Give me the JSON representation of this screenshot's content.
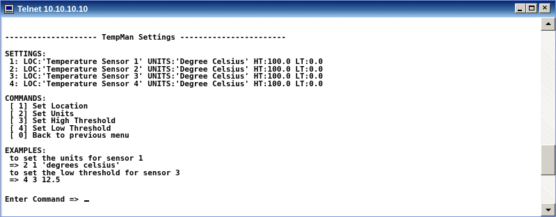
{
  "window": {
    "title": "Telnet 10.10.10.10",
    "minimize_glyph": "",
    "maximize_glyph": "",
    "close_glyph": "×"
  },
  "terminal": {
    "lines": [
      "",
      "-------------------- TempMan Settings -----------------------",
      "",
      "SETTINGS:",
      " 1: LOC:'Temperature Sensor 1' UNITS:'Degree Celsius' HT:100.0 LT:0.0",
      " 2: LOC:'Temperature Sensor 2' UNITS:'Degree Celsius' HT:100.0 LT:0.0",
      " 3: LOC:'Temperature Sensor 3' UNITS:'Degree Celsius' HT:100.0 LT:0.0",
      " 4: LOC:'Temperature Sensor 4' UNITS:'Degree Celsius' HT:100.0 LT:0.0",
      "",
      "COMMANDS:",
      " [ 1] Set Location",
      " [ 2] Set Units",
      " [ 3] Set High Threshold",
      " [ 4] Set Low Threshold",
      " [ 0] Back to previous menu",
      "",
      "EXAMPLES:",
      " to set the units for sensor 1",
      " => 2 1 'degrees celsius'",
      " to set the low threshold for sensor 3",
      " => 4 3 12.5",
      "",
      "Enter Command => "
    ]
  },
  "scrollbar": {
    "position_fraction": 0.72
  }
}
